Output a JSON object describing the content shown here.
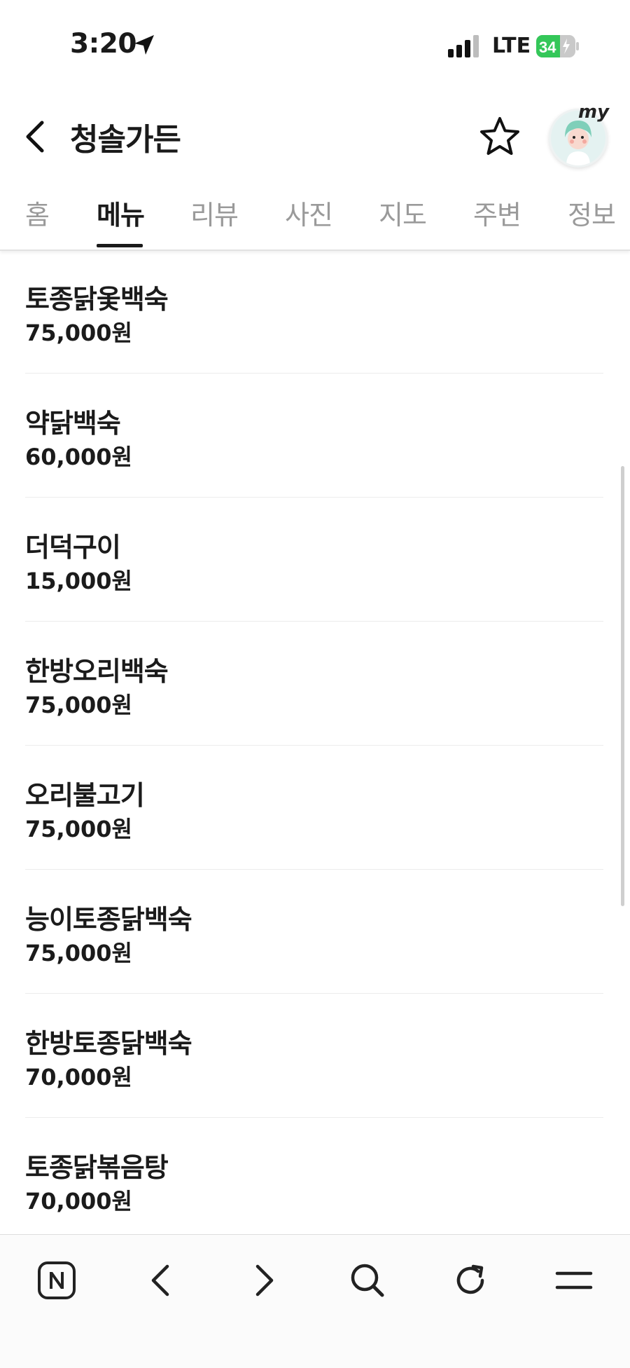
{
  "status_bar": {
    "time": "3:20",
    "network": "LTE",
    "battery": "34"
  },
  "header": {
    "title": "청솔가든",
    "profile_badge": "my"
  },
  "tabs": [
    {
      "label": "홈",
      "active": false
    },
    {
      "label": "메뉴",
      "active": true
    },
    {
      "label": "리뷰",
      "active": false
    },
    {
      "label": "사진",
      "active": false
    },
    {
      "label": "지도",
      "active": false
    },
    {
      "label": "주변",
      "active": false
    },
    {
      "label": "정보",
      "active": false
    }
  ],
  "menu": [
    {
      "name": "토종닭옻백숙",
      "price": "75,000원"
    },
    {
      "name": "약닭백숙",
      "price": "60,000원"
    },
    {
      "name": "더덕구이",
      "price": "15,000원"
    },
    {
      "name": "한방오리백숙",
      "price": "75,000원"
    },
    {
      "name": "오리불고기",
      "price": "75,000원"
    },
    {
      "name": "능이토종닭백숙",
      "price": "75,000원"
    },
    {
      "name": "한방토종닭백숙",
      "price": "70,000원"
    },
    {
      "name": "토종닭볶음탕",
      "price": "70,000원"
    }
  ],
  "toolbar": {
    "icons": [
      "naver-home-icon",
      "back-arrow-icon",
      "forward-arrow-icon",
      "search-icon",
      "refresh-icon",
      "menu-icon"
    ]
  },
  "colors": {
    "battery_green": "#34c759",
    "active_tab": "#1a1a1a",
    "inactive_tab": "#9a9a9a"
  }
}
